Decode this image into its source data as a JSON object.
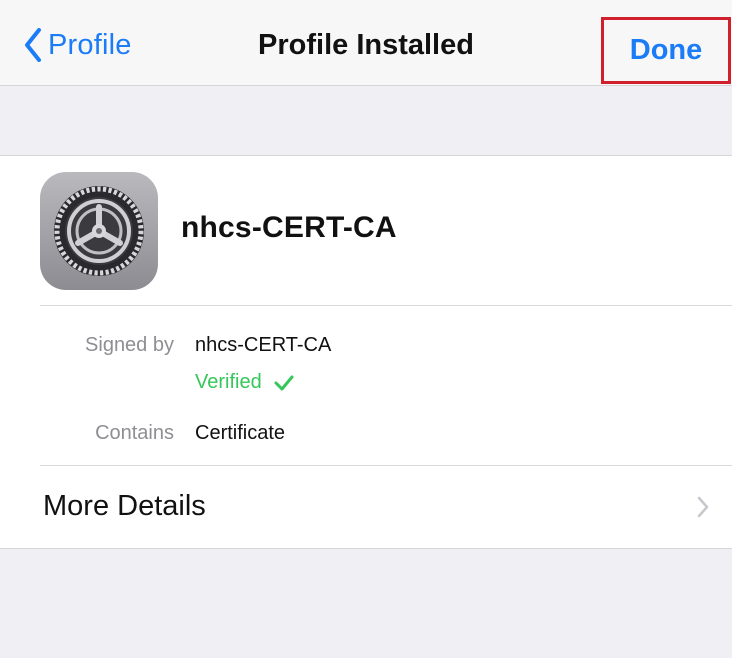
{
  "navbar": {
    "back_label": "Profile",
    "title": "Profile Installed",
    "done_label": "Done"
  },
  "profile": {
    "name": "nhcs-CERT-CA",
    "icon": "settings-gear-icon",
    "signed_by_label": "Signed by",
    "signed_by_value": "nhcs-CERT-CA",
    "verified_label": "Verified",
    "contains_label": "Contains",
    "contains_value": "Certificate"
  },
  "more_details": {
    "label": "More Details"
  },
  "colors": {
    "accent": "#1a7cf6",
    "verified": "#35c759",
    "highlight_box": "#d0202e",
    "background": "#efeff4"
  }
}
